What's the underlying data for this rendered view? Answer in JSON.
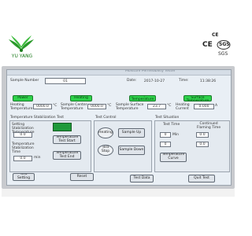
{
  "brand": {
    "name": "YU YANG"
  },
  "certs": {
    "top": "CE",
    "ce": "CE",
    "sgs": "SGS",
    "sgs_label": "SGS"
  },
  "header": {
    "title": "Moisture Permeability Tester"
  },
  "sample": {
    "number_label": "Sample Number",
    "number_value": "01"
  },
  "datetime": {
    "date_label": "Date:",
    "date_value": "2017-10-27",
    "time_label": "Time:",
    "time_value": "11:38:26"
  },
  "status_buttons": {
    "power": "Power",
    "heating": "Heating",
    "sample_temp": "Sample Temperature",
    "sample_surface": "Sample Surface Temperature"
  },
  "readings": [
    {
      "label": "Heating Temperature",
      "value": "0000.0",
      "unit": "°C"
    },
    {
      "label": "Sample Center Temperature",
      "value": "0000.0",
      "unit": "°C"
    },
    {
      "label": "Sample Surface Temperature",
      "value": "23.7",
      "unit": "°C"
    },
    {
      "label": "Heating Current",
      "value": "0.000",
      "unit": "A"
    }
  ],
  "stabilization": {
    "title": "Temperature Stabilization Test",
    "setting_label": "Setting Stabilization Temperature",
    "setting_value": "0.0",
    "time_label": "Temperature Stabilization Time",
    "time_value": "0.0",
    "unit": "min",
    "start_btn": "Temperature Test Start",
    "end_btn": "Temperature Test End"
  },
  "control": {
    "title": "Test Control",
    "heating_btn": "Heating",
    "sample_up_btn": "Sample Up",
    "test_stop_btn": "Test Stop",
    "sample_down_btn": "Sample Down"
  },
  "situation": {
    "title": "Test Situation",
    "test_time_label": "Test Time",
    "flaming_label": "Continued Flaming Time",
    "values": [
      "0",
      "0.0",
      "0",
      "0.0"
    ],
    "unit": "Min",
    "curve_btn": "Temperature Curve"
  },
  "footer": {
    "test_setting": "Test Setting",
    "reset": "Reset",
    "test_data": "Test Data",
    "quit_test": "Quit Test"
  },
  "colors": {
    "screen_bg": "#e9eff5",
    "active_green": "#2ed14a",
    "panel_bg": "#e4eaf0"
  }
}
